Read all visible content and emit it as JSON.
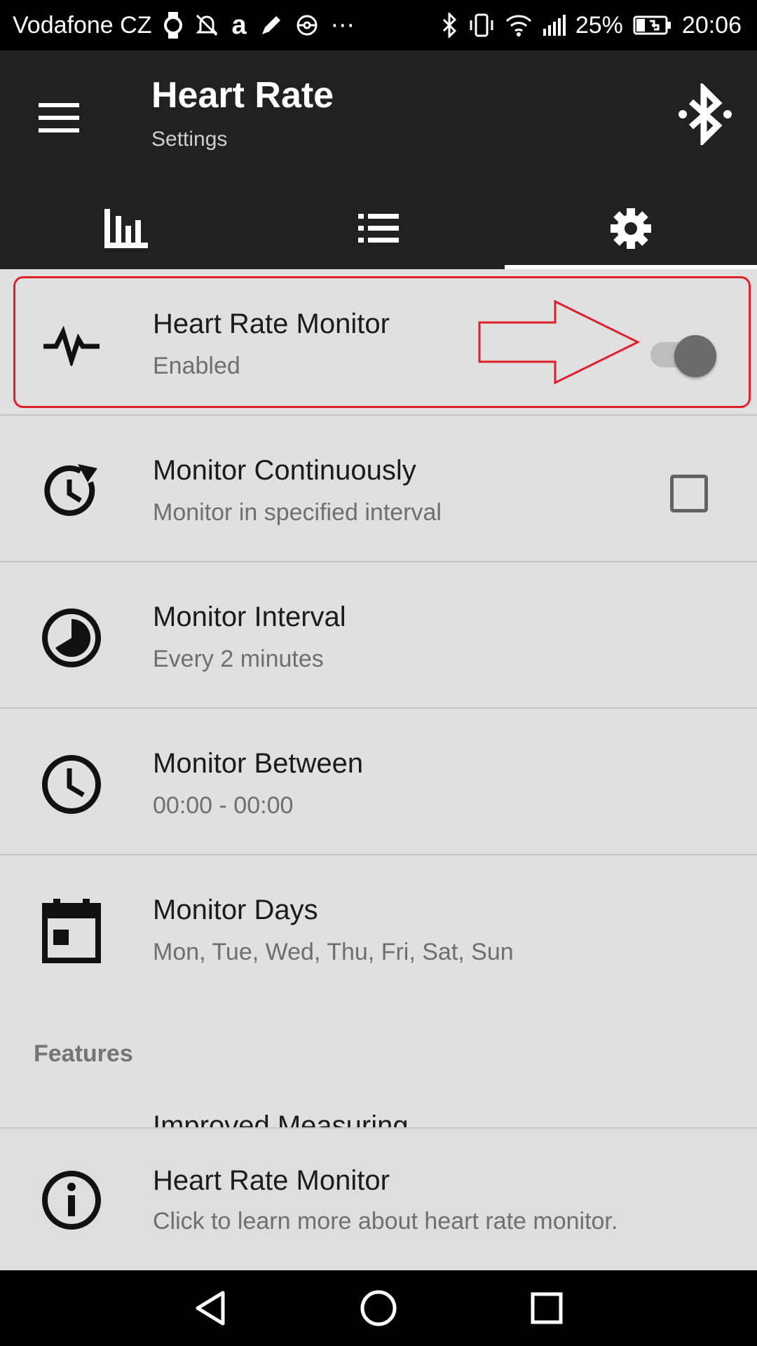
{
  "status_bar": {
    "carrier": "Vodafone CZ",
    "battery_percent": "25%",
    "time": "20:06",
    "icons": [
      "watch-icon",
      "alarm-off-icon",
      "amazon-icon",
      "pencil-icon",
      "pokeball-icon",
      "more-icon",
      "bluetooth-icon",
      "vibrate-icon",
      "wifi-icon",
      "signal-icon",
      "battery-charging-icon"
    ]
  },
  "app_bar": {
    "title": "Heart Rate",
    "subtitle": "Settings",
    "menu_icon": "hamburger-menu-icon",
    "bluetooth_icon": "bluetooth-icon"
  },
  "tabs": [
    {
      "icon": "bar-chart-icon",
      "active": false
    },
    {
      "icon": "list-icon",
      "active": false
    },
    {
      "icon": "gear-icon",
      "active": true
    }
  ],
  "settings": [
    {
      "icon": "heart-pulse-icon",
      "title": "Heart Rate Monitor",
      "subtitle": "Enabled",
      "control": "switch",
      "on": true
    },
    {
      "icon": "clock-refresh-icon",
      "title": "Monitor Continuously",
      "subtitle": "Monitor in specified interval",
      "control": "checkbox",
      "checked": false
    },
    {
      "icon": "clock-pie-icon",
      "title": "Monitor Interval",
      "subtitle": "Every 2 minutes"
    },
    {
      "icon": "clock-icon",
      "title": "Monitor Between",
      "subtitle": "00:00 - 00:00"
    },
    {
      "icon": "calendar-icon",
      "title": "Monitor Days",
      "subtitle": "Mon, Tue, Wed, Thu, Fri, Sat, Sun"
    }
  ],
  "features_header": "Features",
  "partial_item_title": "Improved Measuring",
  "info": {
    "icon": "info-icon",
    "title": "Heart Rate Monitor",
    "subtitle": "Click to learn more about heart rate monitor."
  },
  "annotation": {
    "color": "#e0202a",
    "shape": "arrow-pointing-right"
  },
  "nav": [
    "back-icon",
    "home-icon",
    "recents-icon"
  ],
  "colors": {
    "app_bar": "#212121",
    "background": "#e0e0e0",
    "highlight": "#e0202a"
  }
}
